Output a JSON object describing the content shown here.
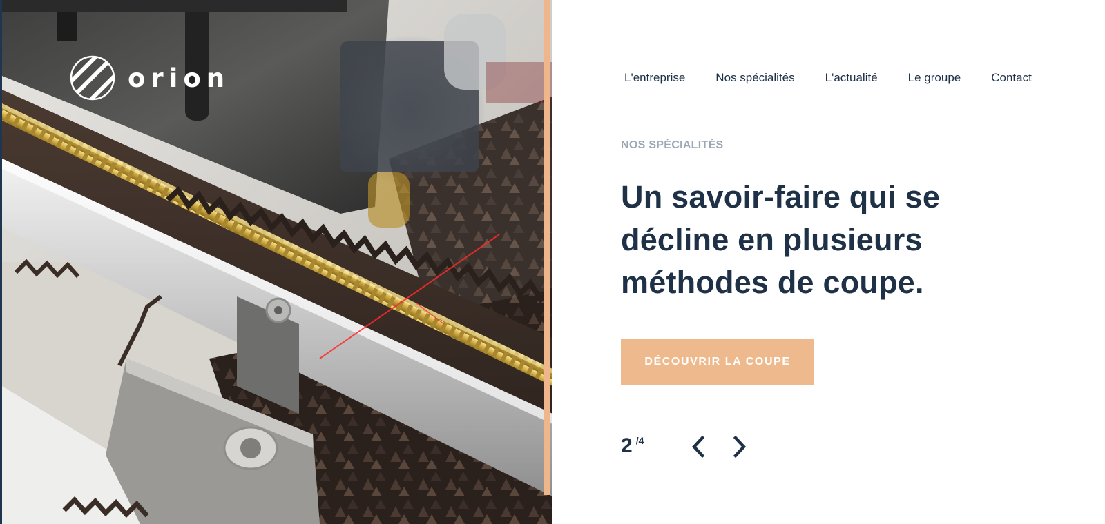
{
  "brand": {
    "name": "orion",
    "logo_icon": "diagonal-stripes-circle-logo-icon"
  },
  "nav": {
    "items": [
      {
        "label": "L'entreprise"
      },
      {
        "label": "Nos spécialités"
      },
      {
        "label": "L'actualité"
      },
      {
        "label": "Le groupe"
      },
      {
        "label": "Contact"
      }
    ]
  },
  "hero": {
    "image_description_icon": "zipper-cutting-machine-photo"
  },
  "section": {
    "eyebrow": "NOS SPÉCIALITÉS",
    "headline_line1": "Un savoir-faire qui se",
    "headline_line2": "décline en plusieurs",
    "headline_line3": "méthodes de coupe.",
    "cta_label": "DÉCOUVRIR LA COUPE"
  },
  "pager": {
    "current": "2",
    "total": "/4",
    "prev_icon": "chevron-left-icon",
    "next_icon": "chevron-right-icon"
  },
  "colors": {
    "navy": "#1e3147",
    "accent": "#efb98e",
    "muted": "#9aa7b4",
    "background": "#ffffff"
  }
}
